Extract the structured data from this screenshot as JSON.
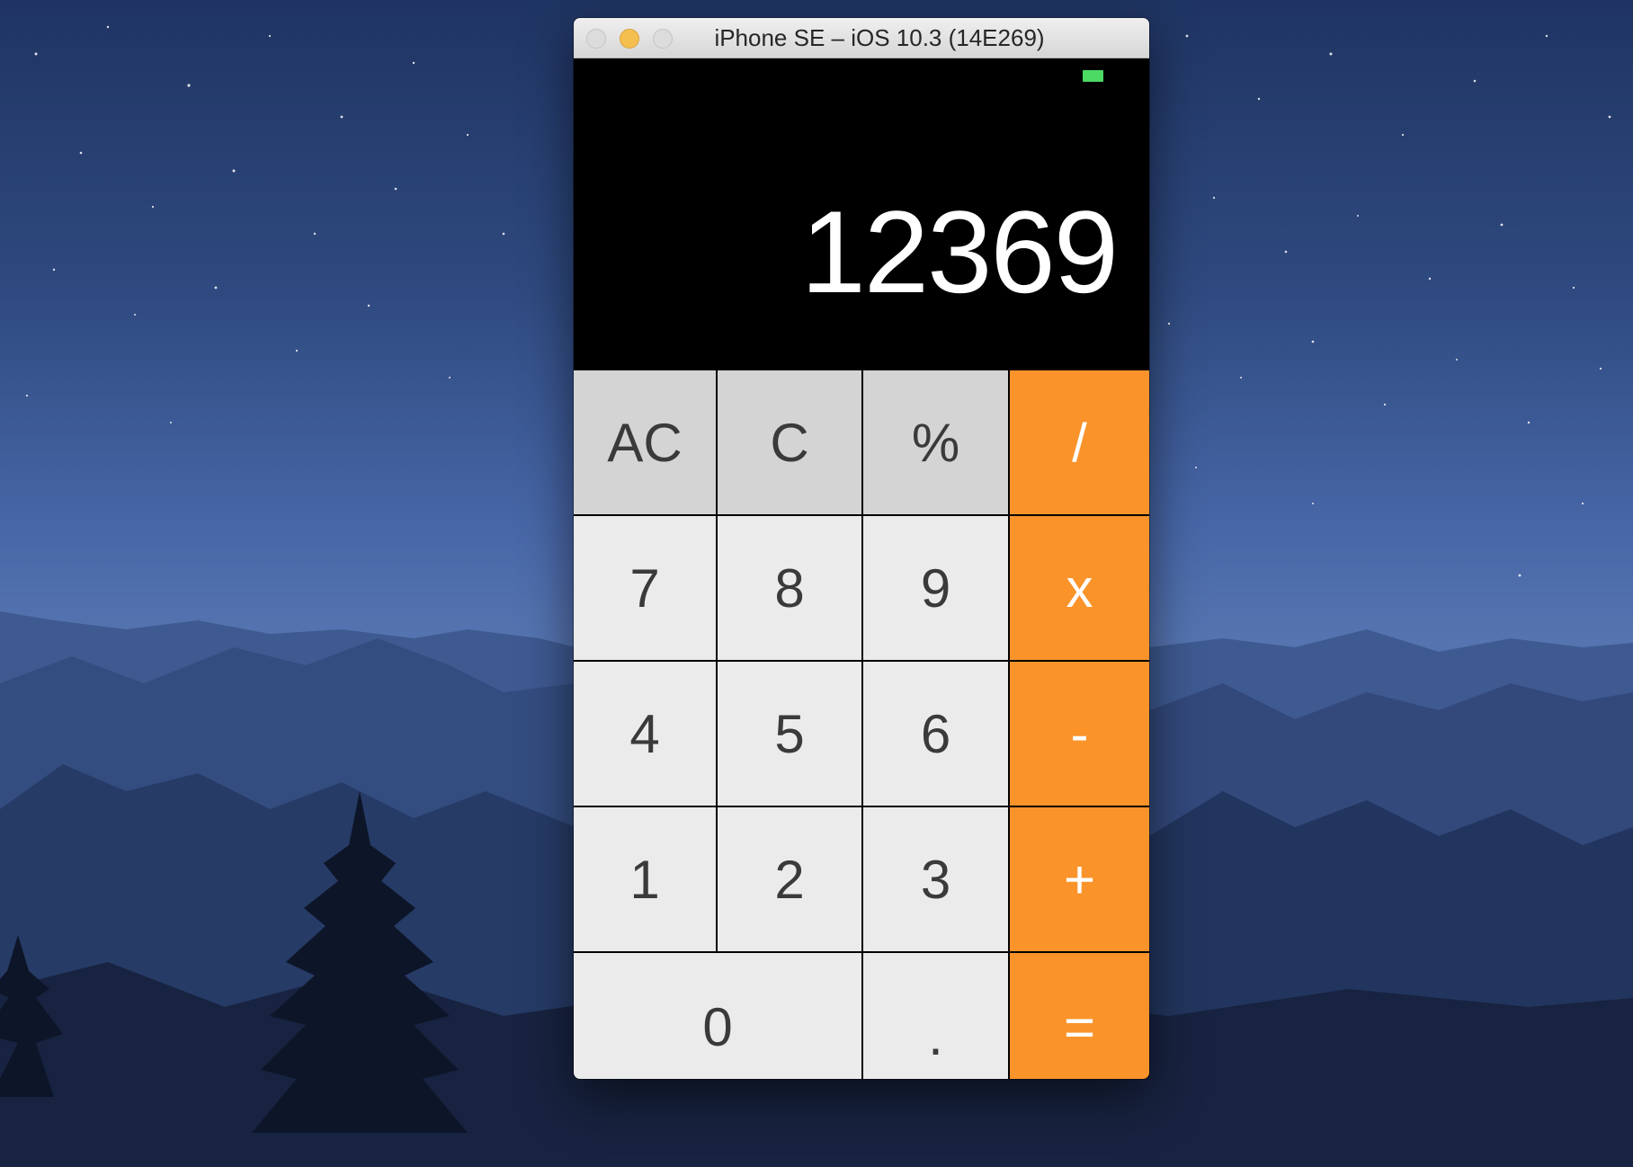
{
  "window": {
    "title": "iPhone SE – iOS 10.3 (14E269)"
  },
  "display": {
    "value": "12369"
  },
  "keys": {
    "ac": "AC",
    "c": "C",
    "percent": "%",
    "divide": "/",
    "seven": "7",
    "eight": "8",
    "nine": "9",
    "multiply": "x",
    "four": "4",
    "five": "5",
    "six": "6",
    "subtract": "-",
    "one": "1",
    "two": "2",
    "three": "3",
    "add": "+",
    "zero": "0",
    "decimal": ".",
    "equals": "="
  },
  "colors": {
    "operator": "#fa932a",
    "function_key": "#d4d4d4",
    "number_key": "#ebebeb",
    "battery": "#4cd964"
  },
  "icons": [
    "battery-icon",
    "close-icon",
    "minimize-icon",
    "zoom-icon"
  ]
}
